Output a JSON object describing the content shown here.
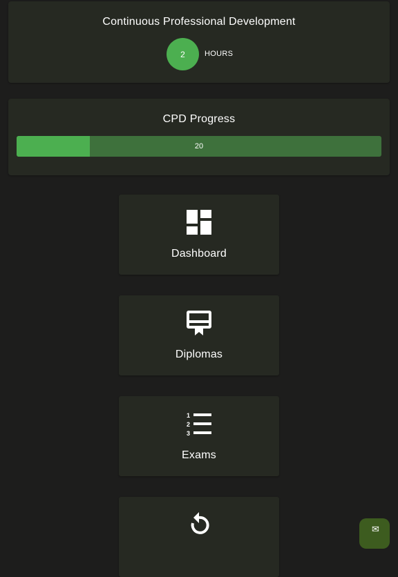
{
  "cpd": {
    "title": "Continuous Professional Development",
    "hours_value": "2",
    "hours_label": "HOURS"
  },
  "progress": {
    "title": "CPD Progress",
    "value_text": "20",
    "percent": 20
  },
  "nav": {
    "dashboard_label": "Dashboard",
    "diplomas_label": "Diplomas",
    "exams_label": "Exams",
    "reset_label": ""
  },
  "icons": {
    "dashboard": "dashboard-grid-icon",
    "diplomas": "certificate-icon",
    "exams": "numbered-list-icon",
    "reset": "refresh-icon",
    "fab": "chat-icon"
  },
  "colors": {
    "background": "#1d1d1c",
    "card": "#262922",
    "accent": "#4caf50",
    "progress_track": "#3e713c",
    "fab": "#3d5c1f"
  }
}
